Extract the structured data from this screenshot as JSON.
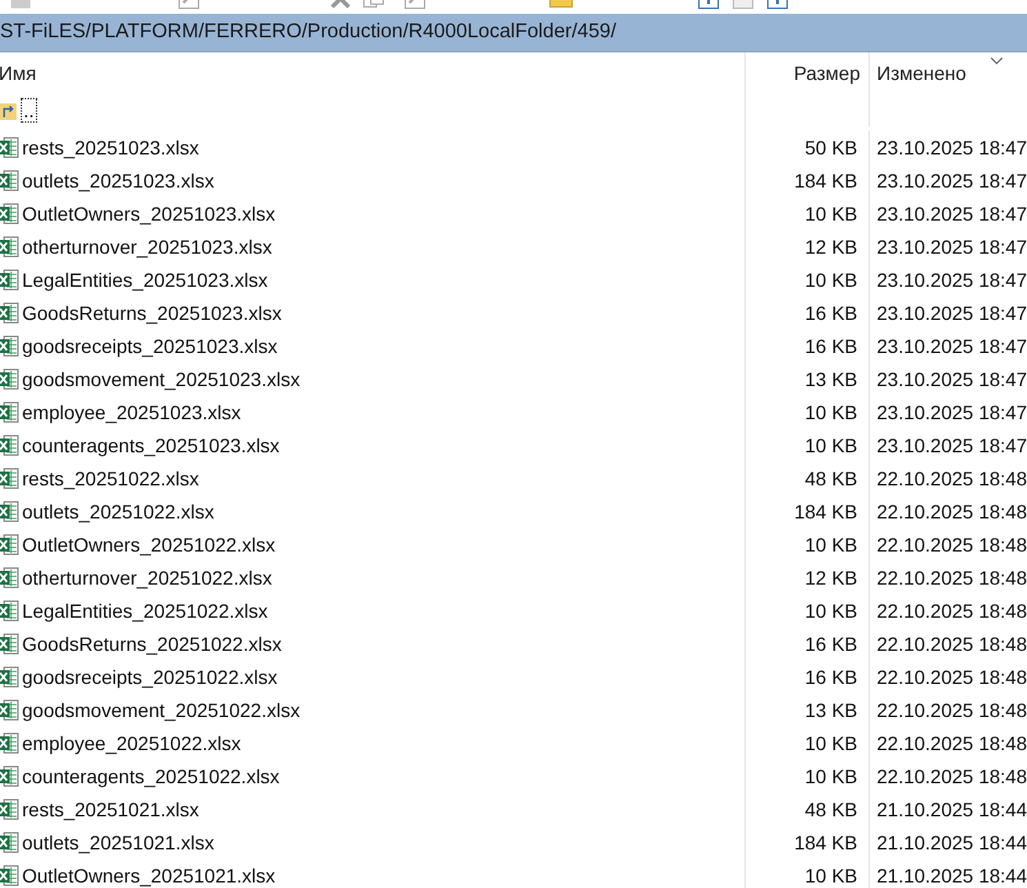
{
  "path": "ST-FiLES/PLATFORM/FERRERO/Production/R4000LocalFolder/459/",
  "columns": {
    "name": "Имя",
    "size": "Размер",
    "modified": "Изменено"
  },
  "parent": {
    "label": "..",
    "selected": true
  },
  "files": [
    {
      "name": "rests_20251023.xlsx",
      "size": "50 KB",
      "modified": "23.10.2025 18:47"
    },
    {
      "name": "outlets_20251023.xlsx",
      "size": "184 KB",
      "modified": "23.10.2025 18:47"
    },
    {
      "name": "OutletOwners_20251023.xlsx",
      "size": "10 KB",
      "modified": "23.10.2025 18:47"
    },
    {
      "name": "otherturnover_20251023.xlsx",
      "size": "12 KB",
      "modified": "23.10.2025 18:47"
    },
    {
      "name": "LegalEntities_20251023.xlsx",
      "size": "10 KB",
      "modified": "23.10.2025 18:47"
    },
    {
      "name": "GoodsReturns_20251023.xlsx",
      "size": "16 KB",
      "modified": "23.10.2025 18:47"
    },
    {
      "name": "goodsreceipts_20251023.xlsx",
      "size": "16 KB",
      "modified": "23.10.2025 18:47"
    },
    {
      "name": "goodsmovement_20251023.xlsx",
      "size": "13 KB",
      "modified": "23.10.2025 18:47"
    },
    {
      "name": "employee_20251023.xlsx",
      "size": "10 KB",
      "modified": "23.10.2025 18:47"
    },
    {
      "name": "counteragents_20251023.xlsx",
      "size": "10 KB",
      "modified": "23.10.2025 18:47"
    },
    {
      "name": "rests_20251022.xlsx",
      "size": "48 KB",
      "modified": "22.10.2025 18:48"
    },
    {
      "name": "outlets_20251022.xlsx",
      "size": "184 KB",
      "modified": "22.10.2025 18:48"
    },
    {
      "name": "OutletOwners_20251022.xlsx",
      "size": "10 KB",
      "modified": "22.10.2025 18:48"
    },
    {
      "name": "otherturnover_20251022.xlsx",
      "size": "12 KB",
      "modified": "22.10.2025 18:48"
    },
    {
      "name": "LegalEntities_20251022.xlsx",
      "size": "10 KB",
      "modified": "22.10.2025 18:48"
    },
    {
      "name": "GoodsReturns_20251022.xlsx",
      "size": "16 KB",
      "modified": "22.10.2025 18:48"
    },
    {
      "name": "goodsreceipts_20251022.xlsx",
      "size": "16 KB",
      "modified": "22.10.2025 18:48"
    },
    {
      "name": "goodsmovement_20251022.xlsx",
      "size": "13 KB",
      "modified": "22.10.2025 18:48"
    },
    {
      "name": "employee_20251022.xlsx",
      "size": "10 KB",
      "modified": "22.10.2025 18:48"
    },
    {
      "name": "counteragents_20251022.xlsx",
      "size": "10 KB",
      "modified": "22.10.2025 18:48"
    },
    {
      "name": "rests_20251021.xlsx",
      "size": "48 KB",
      "modified": "21.10.2025 18:44"
    },
    {
      "name": "outlets_20251021.xlsx",
      "size": "184 KB",
      "modified": "21.10.2025 18:44"
    },
    {
      "name": "OutletOwners_20251021.xlsx",
      "size": "10 KB",
      "modified": "21.10.2025 18:44"
    }
  ]
}
